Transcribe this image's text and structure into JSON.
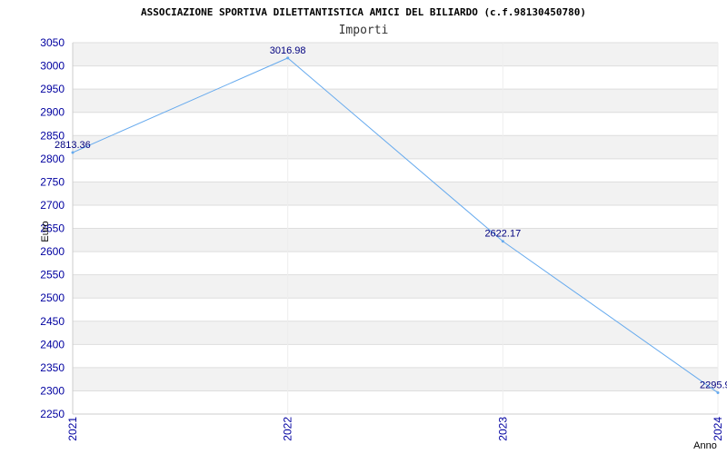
{
  "chart_data": {
    "type": "line",
    "title": "ASSOCIAZIONE SPORTIVA DILETTANTISTICA AMICI DEL BILIARDO (c.f.98130450780)",
    "subtitle": "Importi",
    "xlabel": "Anno",
    "ylabel": "Euro",
    "categories": [
      "2021",
      "2022",
      "2023",
      "2024"
    ],
    "series": [
      {
        "values": [
          2813.36,
          3016.98,
          2622.17,
          2295.9
        ]
      }
    ],
    "data_labels": [
      "2813.36",
      "3016.98",
      "2622.17",
      "2295.9"
    ],
    "yticks": [
      "2250",
      "2300",
      "2350",
      "2400",
      "2450",
      "2500",
      "2550",
      "2600",
      "2650",
      "2700",
      "2750",
      "2800",
      "2850",
      "2900",
      "2950",
      "3000",
      "3050"
    ],
    "ylim": [
      2250,
      3050
    ],
    "grid": true,
    "legend": "none",
    "colors": {
      "line": "#66aaee",
      "band": "#f2f2f2",
      "grid": "#dddddd",
      "tick_text": "#0000a0"
    }
  }
}
